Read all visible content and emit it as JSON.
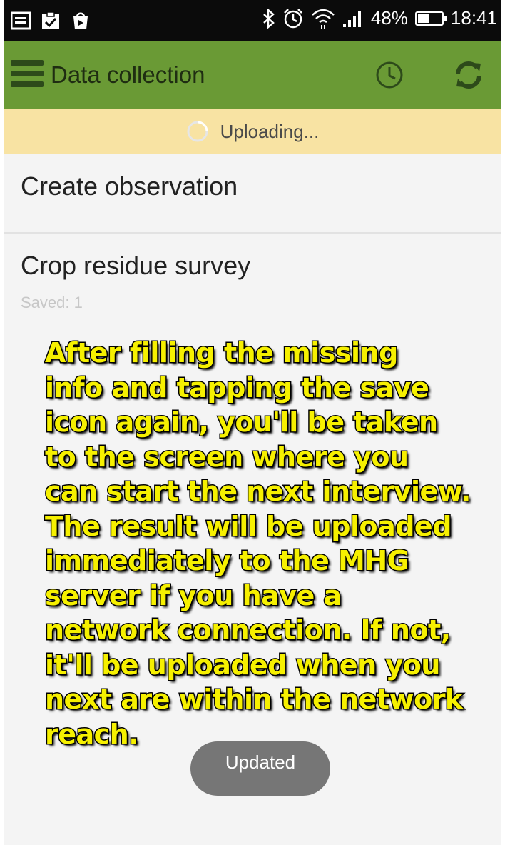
{
  "status_bar": {
    "battery_percent": "48%",
    "time": "18:41",
    "battery_level": 0.48,
    "left_icons": [
      "image-notification-icon",
      "clipboard-check-icon",
      "play-store-icon"
    ],
    "right_icons": [
      "bluetooth-icon",
      "alarm-icon",
      "wifi-icon",
      "signal-icon",
      "battery-icon"
    ]
  },
  "app_bar": {
    "title": "Data collection",
    "background": "#6a9a35",
    "icons": [
      "menu-icon",
      "history-icon",
      "sync-icon"
    ]
  },
  "upload_banner": {
    "text": "Uploading...",
    "background": "#f8e3a3"
  },
  "list": {
    "items": [
      {
        "title": "Create observation"
      },
      {
        "title": "Crop residue survey",
        "subtitle": "Saved: 1"
      }
    ]
  },
  "annotation": {
    "text": "After filling the missing\ninfo and tapping the save\nicon again, you'll be taken\nto the screen where you\ncan start the next interview.\nThe result will be uploaded\nimmediately to the MHG\nserver if you have a\nnetwork connection. If not,\nit'll be uploaded when you\nnext are within the network\nreach.",
    "color": "#f6f000"
  },
  "toast": {
    "text": "Updated"
  }
}
